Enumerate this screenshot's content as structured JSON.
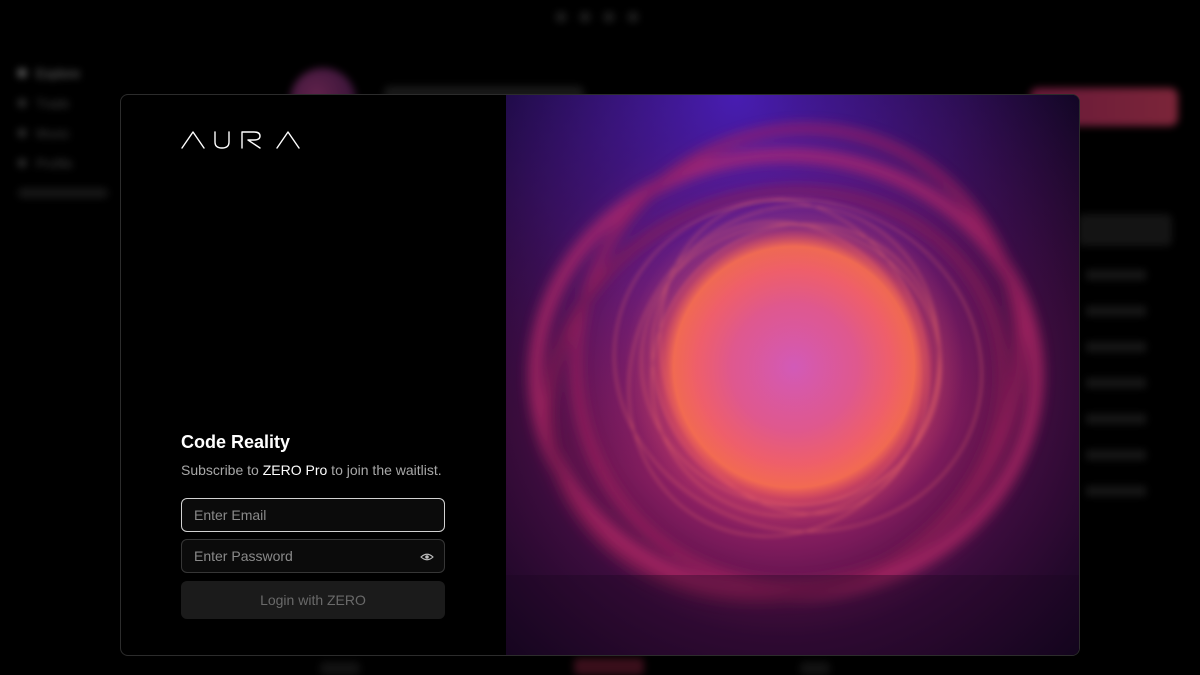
{
  "background": {
    "nav_items": [
      {
        "label": "Explore"
      },
      {
        "label": "Trade"
      },
      {
        "label": "Music"
      },
      {
        "label": "Profile"
      }
    ]
  },
  "modal": {
    "logo_text": "AURA",
    "heading": "Code Reality",
    "subtitle": {
      "prefix": "Subscribe to ",
      "highlight": "ZERO Pro",
      "suffix": " to join the waitlist."
    },
    "email_placeholder": "Enter Email",
    "password_placeholder": "Enter Password",
    "login_label": "Login with ZERO"
  },
  "colors": {
    "accent_magenta": "#d63c7c",
    "accent_orange": "#f26a4a",
    "accent_violet": "#5b1fb0"
  }
}
